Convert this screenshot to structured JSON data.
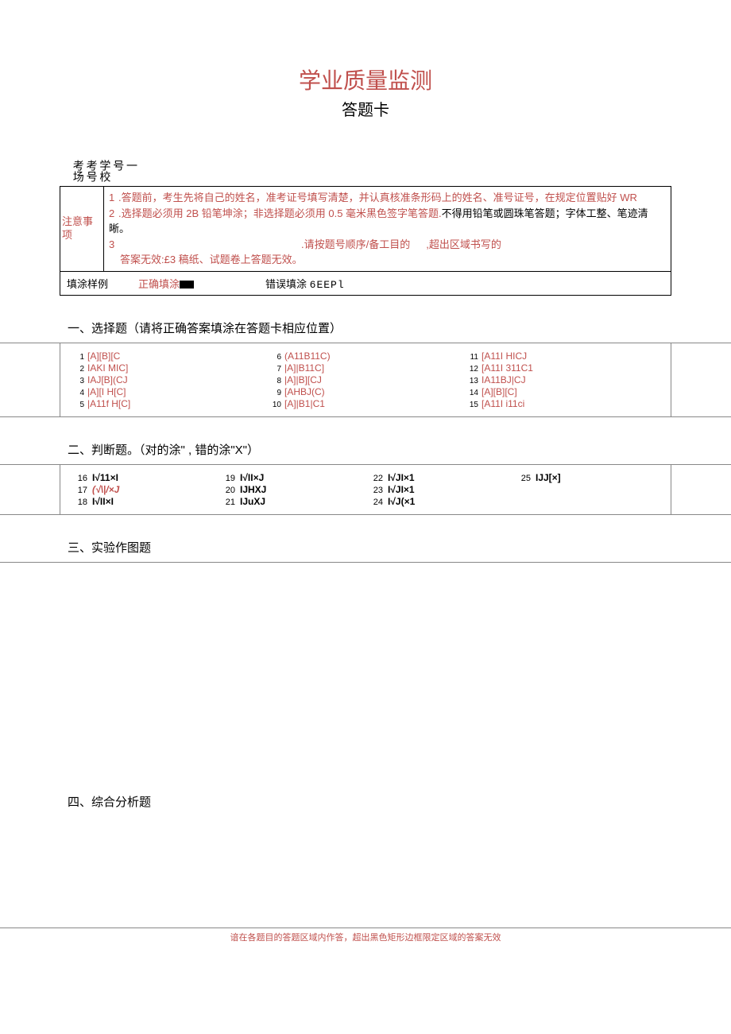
{
  "header": {
    "title_red": "学业质量监测",
    "title_sub": "答题卡"
  },
  "vert_labels": {
    "l1": "一",
    "l2": "号",
    "l3": "学校",
    "l4": "考号",
    "l5": "考场"
  },
  "notice": {
    "label": "注意事项",
    "item1_num": "1",
    "item1_text": ".答题前，考生先将自己的姓名，准考证号填写清楚，并认真核准条形码上的姓名、准号证号，在规定位置贴好 WR",
    "item2_num": "2",
    "item2_text_a": ".选择题必须用 2B 铅笔坤涂；非选择题必须用 0.5 毫米黑色签字笔答题.",
    "item2_text_b": "不得用铅笔或圆珠笔答题；字体工整、笔迹清晰。",
    "item3_num": "3",
    "item3_text_a": ".请按题号顺序/备工目的",
    "item3_text_b": ",超出区域书写的",
    "item3_text_c": "答案无效:£3 稿纸、试题卷上答题无效。"
  },
  "sample": {
    "label": "填涂样例",
    "correct": "正确填涂",
    "wrong_label": "错误填涂",
    "wrong_val": "6EEPl"
  },
  "section1": {
    "title": "一、选择题（请将正确答案填涂在答题卡相应位置）",
    "items": [
      {
        "n": "1",
        "o": "[A][B][C"
      },
      {
        "n": "2",
        "o": "IAKI    MIC]"
      },
      {
        "n": "3",
        "o": "IAJ[B](CJ"
      },
      {
        "n": "4",
        "o": "|A][I    H[C]"
      },
      {
        "n": "5",
        "o": "|A11f  H[C]"
      },
      {
        "n": "6",
        "o": "(A11B11C)"
      },
      {
        "n": "7",
        "o": " |A]|B11C]"
      },
      {
        "n": "8",
        "o": " |A]|B][CJ"
      },
      {
        "n": "9",
        "o": "[AHBJ(C)"
      },
      {
        "n": "10",
        "o": "[A]|B1|C1"
      },
      {
        "n": "11",
        "o": "[A11I   HICJ"
      },
      {
        "n": "12",
        "o": "[A11I   311C1"
      },
      {
        "n": "13",
        "o": "IA11BJ|CJ"
      },
      {
        "n": "14",
        "o": "[A][B][C]"
      },
      {
        "n": "15",
        "o": "[A11I   i11ci"
      }
    ]
  },
  "section2": {
    "title": "二、判断题。（对的涂\" , 错的涂\"X\"）",
    "items": [
      {
        "n": "16",
        "o": "I√11×I"
      },
      {
        "n": "17",
        "o": "(√\\|/×J"
      },
      {
        "n": "18",
        "o": "I√II×I"
      },
      {
        "n": "19",
        "o": "I√II×J"
      },
      {
        "n": "20",
        "o": "IJHXJ"
      },
      {
        "n": "21",
        "o": "IJuXJ"
      },
      {
        "n": "22",
        "o": "I√JI×1"
      },
      {
        "n": "23",
        "o": "I√JI×1"
      },
      {
        "n": "24",
        "o": "I√J(×1"
      },
      {
        "n": "25",
        "o": "IJJ[×]"
      }
    ]
  },
  "section3": {
    "title": "三、实验作图题"
  },
  "section4": {
    "title": "四、综合分析题"
  },
  "footer": "谙在各题目的答题区域内作答，超出黑色矩形边框限定区域的答案无效"
}
